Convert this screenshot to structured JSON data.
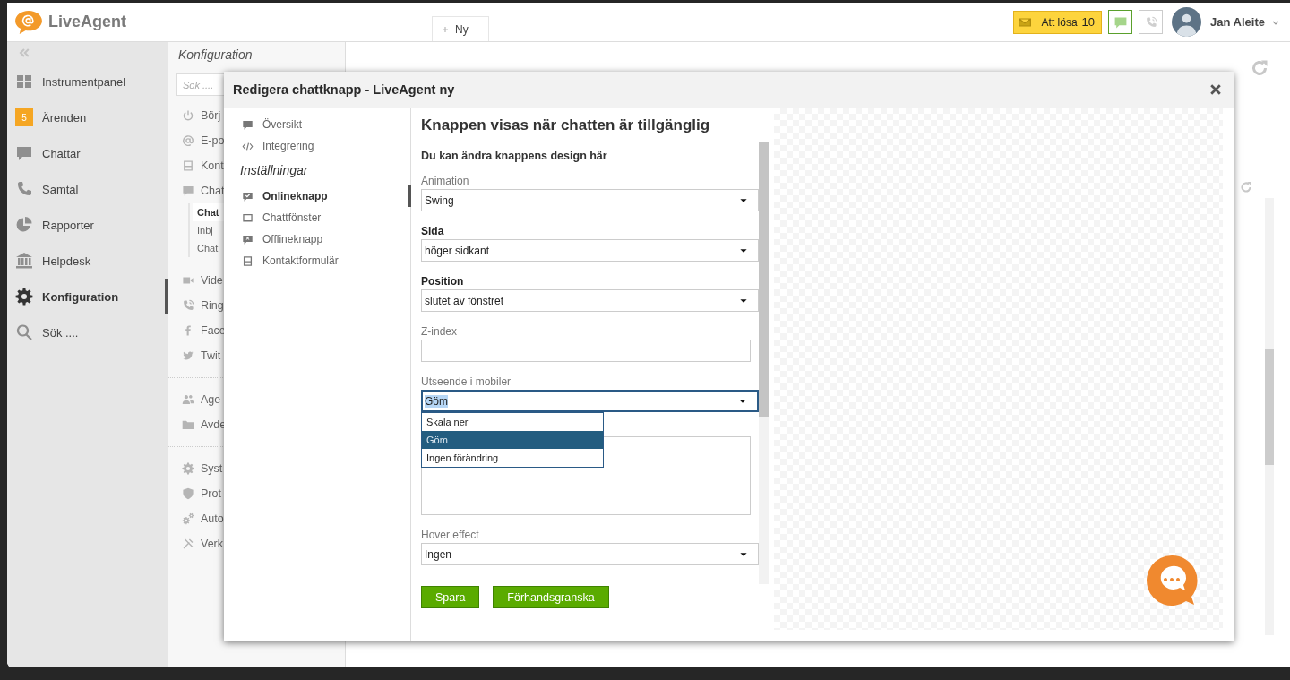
{
  "header": {
    "logo": "LiveAgent",
    "new_tab": {
      "label": "Ny"
    },
    "queue": {
      "label": "Att lösa",
      "count": "10"
    },
    "user": {
      "name": "Jan Aleite"
    }
  },
  "nav": {
    "items": [
      {
        "label": "Instrumentpanel",
        "selected": false
      },
      {
        "label": "Ärenden",
        "badge": "5",
        "selected": false
      },
      {
        "label": "Chattar",
        "selected": false
      },
      {
        "label": "Samtal",
        "selected": false
      },
      {
        "label": "Rapporter",
        "selected": false
      },
      {
        "label": "Helpdesk",
        "selected": false
      },
      {
        "label": "Konfiguration",
        "selected": true
      },
      {
        "label": "Sök ....",
        "selected": false
      }
    ]
  },
  "config_menu": {
    "title": "Konfiguration",
    "search": {
      "placeholder": "Sök ...."
    },
    "groups": [
      {
        "items": [
          {
            "label": "Börj",
            "selected": false
          },
          {
            "label": "E-po",
            "selected": false
          },
          {
            "label": "Kont",
            "selected": false
          },
          {
            "label": "Chat",
            "selected": false,
            "children": [
              {
                "label": "Chat",
                "selected": true
              },
              {
                "label": "Inbj",
                "selected": false
              },
              {
                "label": "Chat",
                "selected": false
              }
            ]
          },
          {
            "label": "Vide",
            "selected": false
          },
          {
            "label": "Ring",
            "selected": false
          },
          {
            "label": "Face",
            "selected": false
          },
          {
            "label": "Twit",
            "selected": false
          }
        ]
      },
      {
        "items": [
          {
            "label": "Age",
            "selected": false
          },
          {
            "label": "Avde",
            "selected": false
          }
        ]
      },
      {
        "items": [
          {
            "label": "Syst",
            "selected": false
          },
          {
            "label": "Prot",
            "selected": false
          },
          {
            "label": "Auto",
            "selected": false
          },
          {
            "label": "Verk",
            "selected": false
          }
        ]
      }
    ]
  },
  "modal": {
    "title": "Redigera chattknapp - LiveAgent ny",
    "nav": {
      "items": [
        {
          "label": "Översikt",
          "selected": false
        },
        {
          "label": "Integrering",
          "selected": false
        }
      ],
      "section": "Inställningar",
      "settings": [
        {
          "label": "Onlineknapp",
          "selected": true
        },
        {
          "label": "Chattfönster",
          "selected": false
        },
        {
          "label": "Offlineknapp",
          "selected": false
        },
        {
          "label": "Kontaktformulär",
          "selected": false
        }
      ]
    },
    "form": {
      "heading": "Knappen visas när chatten är tillgänglig",
      "subheading": "Du kan ändra knappens design här",
      "fields": [
        {
          "kind": "select",
          "label": "Animation",
          "required": false,
          "value": "Swing",
          "focused": false
        },
        {
          "kind": "select",
          "label": "Sida",
          "required": true,
          "value": "höger sidkant",
          "focused": false
        },
        {
          "kind": "select",
          "label": "Position",
          "required": true,
          "value": "slutet av fönstret",
          "focused": false
        },
        {
          "kind": "text",
          "label": "Z-index",
          "required": false
        },
        {
          "kind": "select",
          "label": "Utseende i mobiler",
          "required": false,
          "value": "Göm",
          "focused": true,
          "expanded": true,
          "options": [
            {
              "label": "Skala ner",
              "selected": false
            },
            {
              "label": "Göm",
              "selected": true
            },
            {
              "label": "Ingen förändring",
              "selected": false
            }
          ]
        },
        {
          "kind": "textarea"
        },
        {
          "kind": "select",
          "label": "Hover effect",
          "required": false,
          "value": "Ingen",
          "focused": false
        }
      ],
      "buttons": [
        {
          "label": "Spara"
        },
        {
          "label": "Förhandsgranska"
        }
      ]
    }
  }
}
